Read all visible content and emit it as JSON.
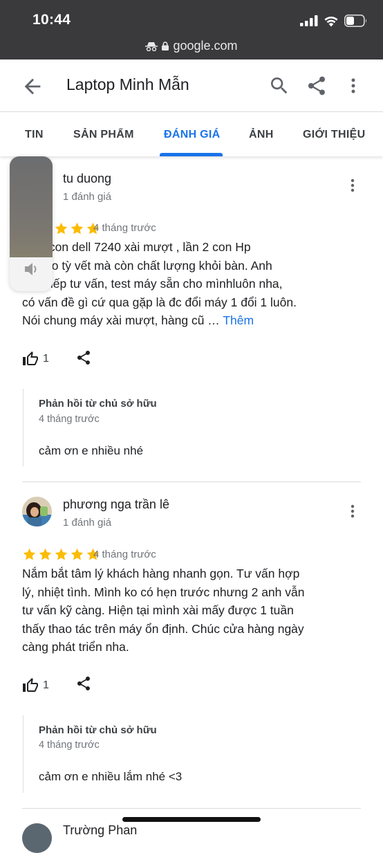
{
  "status_bar": {
    "time": "10:44",
    "url": "google.com"
  },
  "app_bar": {
    "title": "Laptop Minh Mẫn"
  },
  "tabs": [
    {
      "label": "TIN",
      "active": false
    },
    {
      "label": "SẢN PHẨM",
      "active": false
    },
    {
      "label": "ĐÁNH GIÁ",
      "active": true
    },
    {
      "label": "ẢNH",
      "active": false
    },
    {
      "label": "GIỚI THIỆU",
      "active": false
    }
  ],
  "volume": {
    "level": 0.75
  },
  "reviews": [
    {
      "name": "tu duong",
      "review_count": "1 đánh giá",
      "rating": 5,
      "time": "4 tháng trước",
      "text_lines": [
        "mua con dell 7240 xài mượt , lần 2 con Hp",
        "đẹp ko tỳ vết mà còn chất lượng khỏi bàn. Anh",
        "trực tiếp tư vấn, test máy sẵn cho mìnhluôn nha,",
        "có vấn đề gì cứ qua gặp là đc đổi máy 1 đổi 1 luôn.",
        "Nói chung máy xài mượt, hàng cũ …"
      ],
      "more_label": "Thêm",
      "likes": "1",
      "owner_reply": {
        "title": "Phản hồi từ chủ sở hữu",
        "time": "4 tháng trước",
        "text": "cảm ơn e nhiều nhé"
      }
    },
    {
      "name": "phương nga trần lê",
      "review_count": "1 đánh giá",
      "rating": 5,
      "time": "4 tháng trước",
      "text_lines": [
        "Nắm bắt tâm lý khách hàng nhanh gọn. Tư vấn hợp",
        "lý, nhiệt tình. Mình ko có hẹn trước nhưng 2 anh vẫn",
        "tư vấn kỹ càng. Hiện tại mình xài mấy được 1 tuần",
        "thấy thao tác trên máy ổn định. Chúc cửa hàng ngày",
        "càng phát triển nha."
      ],
      "likes": "1",
      "owner_reply": {
        "title": "Phản hồi từ chủ sở hữu",
        "time": "4 tháng trước",
        "text": "cảm ơn e nhiều lắm nhé <3"
      }
    },
    {
      "name": "Trường Phan"
    }
  ],
  "colors": {
    "accent": "#1a73e8",
    "star": "#fbbc04",
    "status_bar_bg": "#3a3a3c"
  }
}
